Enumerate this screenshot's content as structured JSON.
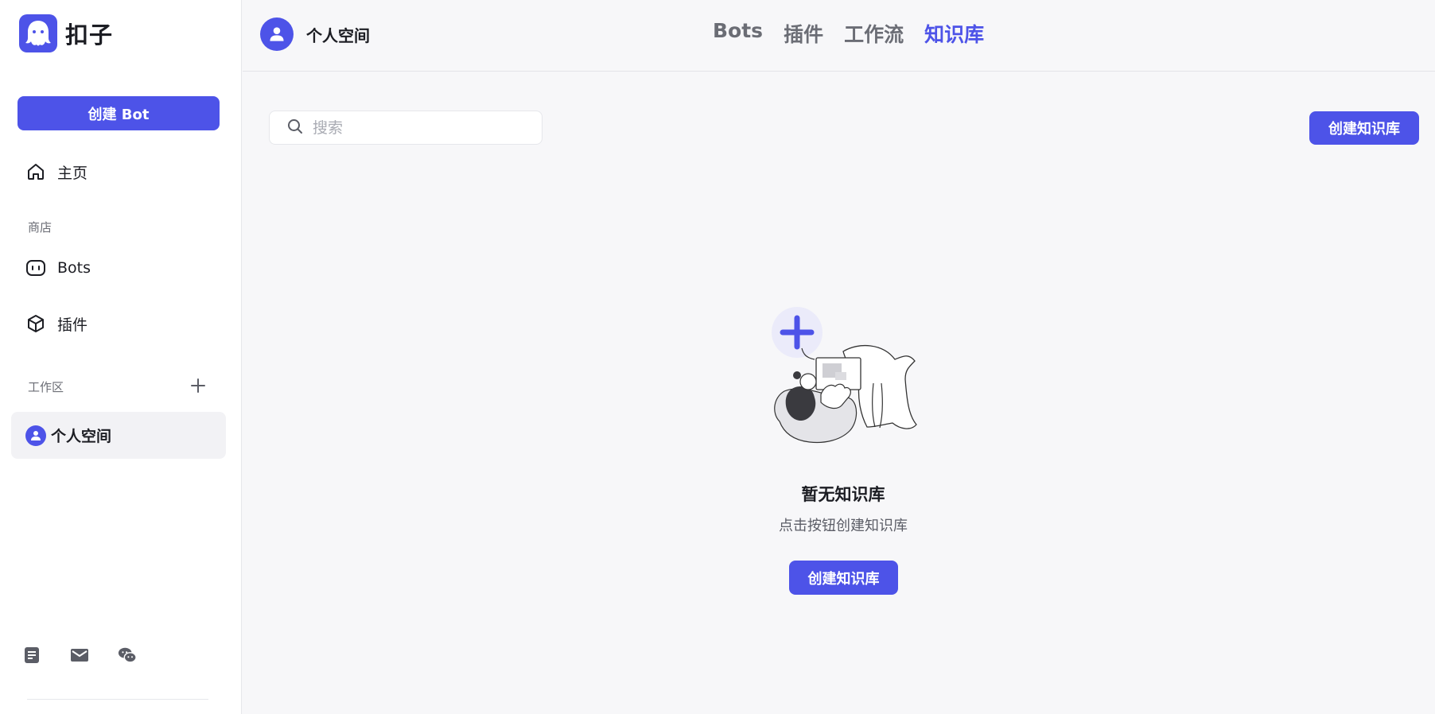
{
  "app": {
    "name": "扣子",
    "brand_color": "#4d53e8"
  },
  "sidebar": {
    "create_bot_label": "创建 Bot",
    "home_label": "主页",
    "store_section_label": "商店",
    "store_items": [
      {
        "label": "Bots",
        "icon": "bot-icon"
      },
      {
        "label": "插件",
        "icon": "cube-icon"
      }
    ],
    "workspace_section_label": "工作区",
    "workspace_item_label": "个人空间",
    "footer_icons": [
      "document-icon",
      "mail-icon",
      "wechat-icon"
    ]
  },
  "header": {
    "space_name": "个人空间",
    "tabs": [
      {
        "label": "Bots",
        "active": false
      },
      {
        "label": "插件",
        "active": false
      },
      {
        "label": "工作流",
        "active": false
      },
      {
        "label": "知识库",
        "active": true
      }
    ]
  },
  "main": {
    "search": {
      "placeholder": "搜索",
      "value": ""
    },
    "create_button_label": "创建知识库",
    "empty_state": {
      "title": "暂无知识库",
      "description": "点击按钮创建知识库",
      "button_label": "创建知识库"
    }
  }
}
